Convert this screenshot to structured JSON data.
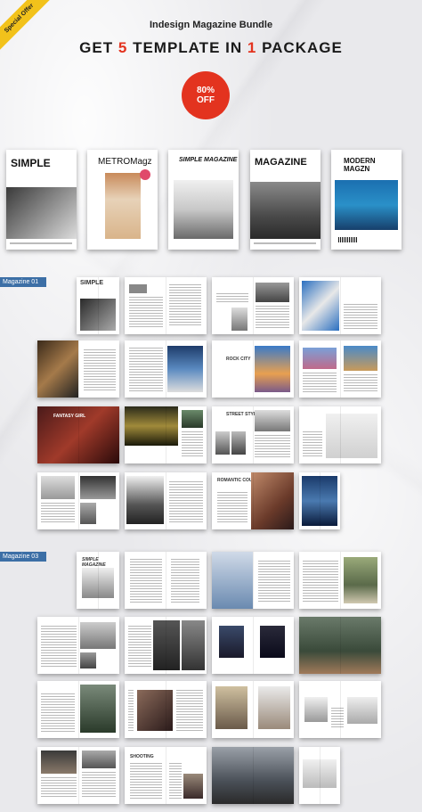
{
  "ribbon": "Special Offer",
  "header": {
    "subtitle": "Indesign Magazine Bundle",
    "headline_prefix": "GET",
    "num1": "5",
    "headline_mid": "TEMPLATE IN",
    "num2": "1",
    "headline_suffix": "PACKAGE"
  },
  "badge": {
    "line1": "80%",
    "line2": "OFF"
  },
  "covers": [
    {
      "title": "SIMPLE"
    },
    {
      "title": "METROMagz"
    },
    {
      "title": "SIMPLE MAGAZINE"
    },
    {
      "title": "MAGAZINE"
    },
    {
      "title": "MODERN MAGZN"
    }
  ],
  "sections": [
    {
      "label": "Magazine 01"
    },
    {
      "label": "Magazine 03"
    }
  ],
  "spread_titles": {
    "simple": "SIMPLE",
    "rock_city": "ROCK CITY",
    "fantasy_girl": "FANTASY GIRL",
    "street_styles": "STREET STYLES",
    "romantic_couple": "ROMANTIC COUPLE",
    "simple_magazine": "SIMPLE MAGAZINE",
    "shooting": "SHOOTING"
  },
  "colors": {
    "accent": "#e3331f",
    "label_bg": "#3c6fa6",
    "ribbon": "#f2c21b"
  }
}
